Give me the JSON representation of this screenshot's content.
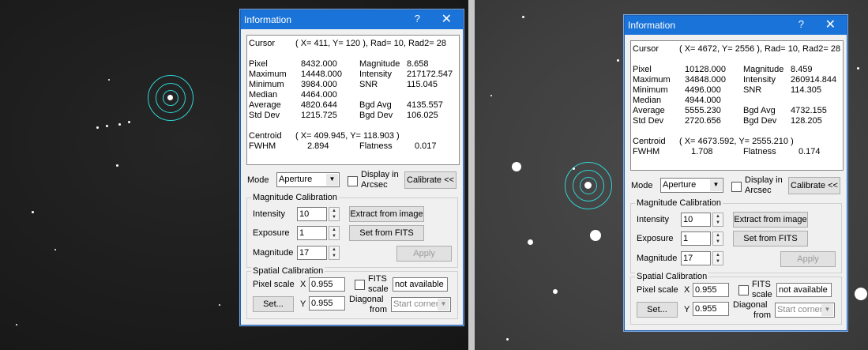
{
  "dialogs": [
    {
      "title": "Information",
      "help_glyph": "?",
      "close_glyph": "✕",
      "cursor_label": "Cursor",
      "cursor_value": "( X=  411, Y=  120 ), Rad= 10, Rad2= 28",
      "stats_left": [
        {
          "label": "Pixel",
          "value": "8432.000"
        },
        {
          "label": "Maximum",
          "value": "14448.000"
        },
        {
          "label": "Minimum",
          "value": "3984.000"
        },
        {
          "label": "Median",
          "value": "4464.000"
        },
        {
          "label": "Average",
          "value": "4820.644"
        },
        {
          "label": "Std Dev",
          "value": "1215.725"
        }
      ],
      "stats_right": [
        {
          "label": "Magnitude",
          "value": "8.658"
        },
        {
          "label": "Intensity",
          "value": "217172.547"
        },
        {
          "label": "SNR",
          "value": "115.045"
        },
        {
          "label": "",
          "value": ""
        },
        {
          "label": "Bgd Avg",
          "value": "4135.557"
        },
        {
          "label": "Bgd Dev",
          "value": "106.025"
        }
      ],
      "centroid_label": "Centroid",
      "centroid_value": "( X=  409.945, Y=  118.903 )",
      "fwhm_label": "FWHM",
      "fwhm_value": "2.894",
      "flatness_label": "Flatness",
      "flatness_value": "0.017",
      "mode_label": "Mode",
      "mode_value": "Aperture",
      "arcsec_label_1": "Display in",
      "arcsec_label_2": "Arcsec",
      "calibrate_label": "Calibrate <<",
      "mag_group": "Magnitude Calibration",
      "intensity_label": "Intensity",
      "intensity_value": "10",
      "exposure_label": "Exposure",
      "exposure_value": "1",
      "magnitude_label": "Magnitude",
      "magnitude_value": "17",
      "extract_label": "Extract from image",
      "setfits_label": "Set from FITS",
      "apply_label": "Apply",
      "spatial_group": "Spatial Calibration",
      "pixscale_label": "Pixel scale",
      "x_label": "X",
      "x_value": "0.955",
      "y_label": "Y",
      "y_value": "0.955",
      "set_label": "Set...",
      "fits_label_1": "FITS",
      "fits_label_2": "scale",
      "na_value": "not available",
      "diag_label_1": "Diagonal",
      "diag_label_2": "from",
      "start_corner": "Start corner"
    },
    {
      "title": "Information",
      "help_glyph": "?",
      "close_glyph": "✕",
      "cursor_label": "Cursor",
      "cursor_value": "( X= 4672, Y= 2556 ), Rad= 10, Rad2= 28",
      "stats_left": [
        {
          "label": "Pixel",
          "value": "10128.000"
        },
        {
          "label": "Maximum",
          "value": "34848.000"
        },
        {
          "label": "Minimum",
          "value": "4496.000"
        },
        {
          "label": "Median",
          "value": "4944.000"
        },
        {
          "label": "Average",
          "value": "5555.230"
        },
        {
          "label": "Std Dev",
          "value": "2720.656"
        }
      ],
      "stats_right": [
        {
          "label": "Magnitude",
          "value": "8.459"
        },
        {
          "label": "Intensity",
          "value": "260914.844"
        },
        {
          "label": "SNR",
          "value": "114.305"
        },
        {
          "label": "",
          "value": ""
        },
        {
          "label": "Bgd Avg",
          "value": "4732.155"
        },
        {
          "label": "Bgd Dev",
          "value": "128.205"
        }
      ],
      "centroid_label": "Centroid",
      "centroid_value": "( X= 4673.592, Y= 2555.210 )",
      "fwhm_label": "FWHM",
      "fwhm_value": "1.708",
      "flatness_label": "Flatness",
      "flatness_value": "0.174",
      "mode_label": "Mode",
      "mode_value": "Aperture",
      "arcsec_label_1": "Display in",
      "arcsec_label_2": "Arcsec",
      "calibrate_label": "Calibrate <<",
      "mag_group": "Magnitude Calibration",
      "intensity_label": "Intensity",
      "intensity_value": "10",
      "exposure_label": "Exposure",
      "exposure_value": "1",
      "magnitude_label": "Magnitude",
      "magnitude_value": "17",
      "extract_label": "Extract from image",
      "setfits_label": "Set from FITS",
      "apply_label": "Apply",
      "spatial_group": "Spatial Calibration",
      "pixscale_label": "Pixel scale",
      "x_label": "X",
      "x_value": "0.955",
      "y_label": "Y",
      "y_value": "0.955",
      "set_label": "Set...",
      "fits_label_1": "FITS",
      "fits_label_2": "scale",
      "na_value": "not available",
      "diag_label_1": "Diagonal",
      "diag_label_2": "from",
      "start_corner": "Start corner"
    }
  ]
}
